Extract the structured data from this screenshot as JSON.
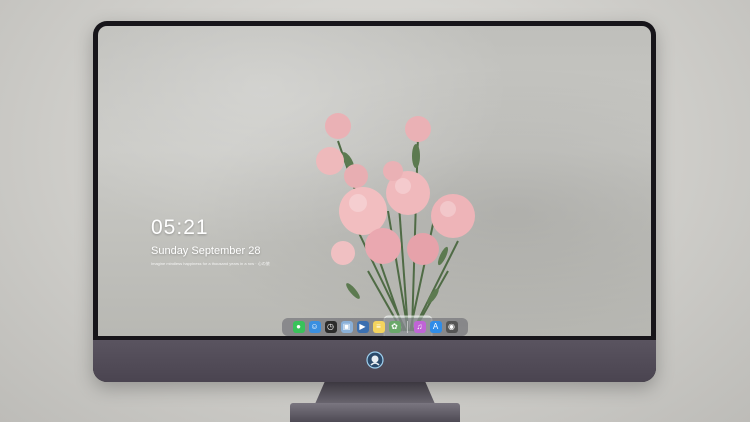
{
  "lockscreen": {
    "time": "05:21",
    "date": "Sunday September  28",
    "subtext": "Imagine mindless happiness for a thousand years in a row · 心の旅"
  },
  "dock": {
    "icons": [
      {
        "name": "messages-icon",
        "color": "#39c25a",
        "glyph": "●"
      },
      {
        "name": "finder-icon",
        "color": "#3a8fe0",
        "glyph": "☺"
      },
      {
        "name": "clock-icon",
        "color": "#2b2b2b",
        "glyph": "◷"
      },
      {
        "name": "preview-icon",
        "color": "#8ab0d8",
        "glyph": "▣"
      },
      {
        "name": "finalcut-icon",
        "color": "#3b6fb0",
        "glyph": "▶"
      },
      {
        "name": "notes-icon",
        "color": "#f4d35e",
        "glyph": "≡"
      },
      {
        "name": "photos-icon",
        "color": "#6aa86a",
        "glyph": "✿"
      },
      {
        "name": "itunes-icon",
        "color": "#c064d6",
        "glyph": "♫"
      },
      {
        "name": "appstore-icon",
        "color": "#2f8ce8",
        "glyph": "A"
      },
      {
        "name": "camera-icon",
        "color": "#555555",
        "glyph": "◉"
      }
    ]
  }
}
